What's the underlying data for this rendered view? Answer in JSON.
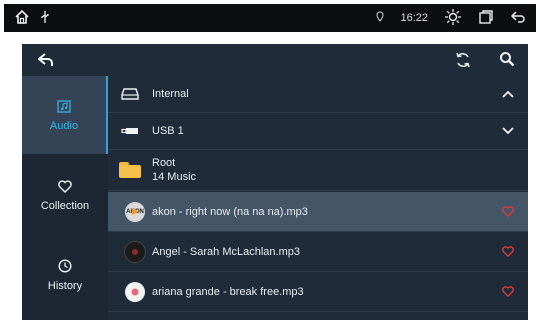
{
  "status": {
    "time": "16:22"
  },
  "sidebar": {
    "items": [
      {
        "label": "Audio",
        "icon": "audio-folder-icon",
        "active": true
      },
      {
        "label": "Collection",
        "icon": "heart-outline-icon",
        "active": false
      },
      {
        "label": "History",
        "icon": "clock-icon",
        "active": false
      }
    ]
  },
  "sources": [
    {
      "label": "Internal",
      "icon": "drive-icon",
      "expanded": true
    },
    {
      "label": "USB 1",
      "icon": "usb-icon",
      "expanded": false
    }
  ],
  "folder": {
    "name": "Root",
    "count": "14 Music"
  },
  "tracks": [
    {
      "title": "akon - right now (na na na).mp3",
      "art_text": "AKON",
      "art_color": "#d9d9d9",
      "playing": true
    },
    {
      "title": "Angel - Sarah McLachlan.mp3",
      "art_text": "",
      "art_color": "#1b1b1b",
      "playing": false
    },
    {
      "title": "ariana grande - break free.mp3",
      "art_text": "",
      "art_color": "#f2f2f2",
      "playing": false
    }
  ],
  "colors": {
    "accent": "#2ea7d8",
    "favorite": "#e23b3b",
    "selected_row": "#455568",
    "panel": "#1f2b38"
  }
}
